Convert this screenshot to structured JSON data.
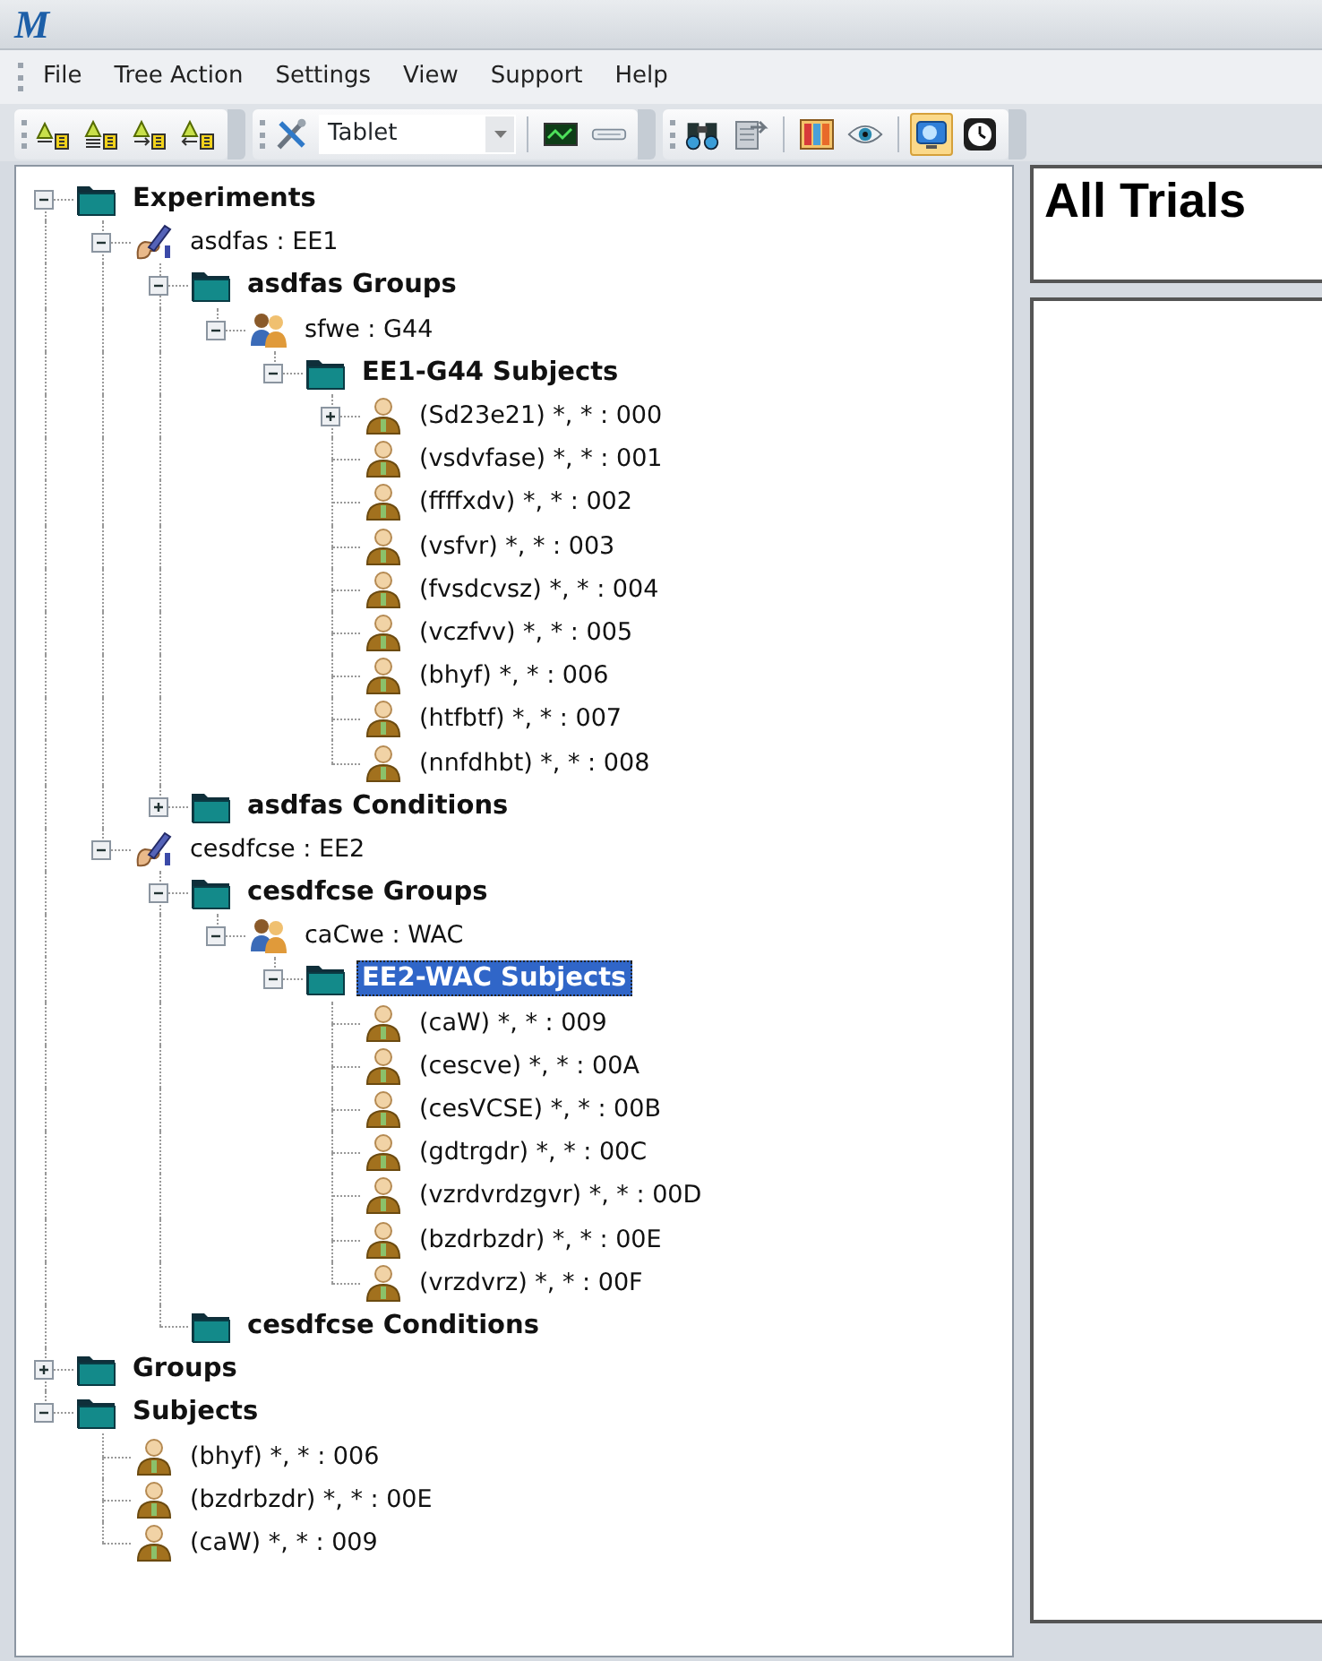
{
  "window": {
    "title": "M"
  },
  "menu": [
    "File",
    "Tree Action",
    "Settings",
    "View",
    "Support",
    "Help"
  ],
  "toolbars": [
    {
      "items": [
        {
          "kind": "sort-a",
          "pressed": false
        },
        {
          "kind": "sort-b",
          "pressed": false
        },
        {
          "kind": "sort-c",
          "pressed": false
        },
        {
          "kind": "sort-d",
          "pressed": false
        }
      ]
    },
    {
      "items": [
        {
          "kind": "tools",
          "pressed": false
        },
        {
          "kind": "combo",
          "value": "Tablet"
        },
        {
          "kind": "separator"
        },
        {
          "kind": "monitor-wave",
          "pressed": false
        },
        {
          "kind": "bar",
          "pressed": false
        }
      ]
    },
    {
      "items": [
        {
          "kind": "binoculars",
          "pressed": false
        },
        {
          "kind": "doc-arrow",
          "pressed": false
        },
        {
          "kind": "separator"
        },
        {
          "kind": "color-bars",
          "pressed": false
        },
        {
          "kind": "eye",
          "pressed": false
        },
        {
          "kind": "separator"
        },
        {
          "kind": "globe-monitor",
          "pressed": true
        },
        {
          "kind": "clock",
          "pressed": false
        }
      ]
    }
  ],
  "tree": [
    {
      "kind": "folder",
      "label": "Experiments",
      "expanded": true,
      "selected": false,
      "children": [
        {
          "kind": "experiment",
          "label": "asdfas : EE1",
          "expanded": true,
          "selected": false,
          "children": [
            {
              "kind": "folder",
              "label": "asdfas Groups",
              "expanded": true,
              "selected": false,
              "children": [
                {
                  "kind": "group",
                  "label": "sfwe : G44",
                  "expanded": true,
                  "selected": false,
                  "children": [
                    {
                      "kind": "folder",
                      "label": "EE1-G44 Subjects",
                      "expanded": true,
                      "selected": false,
                      "children": [
                        {
                          "kind": "subject",
                          "label": "(Sd23e21) *, * : 000",
                          "expanded": false,
                          "selected": false
                        },
                        {
                          "kind": "subject",
                          "label": "(vsdvfase) *, * : 001",
                          "selected": false
                        },
                        {
                          "kind": "subject",
                          "label": "(ffffxdv) *, * : 002",
                          "selected": false
                        },
                        {
                          "kind": "subject",
                          "label": "(vsfvr) *, * : 003",
                          "selected": false
                        },
                        {
                          "kind": "subject",
                          "label": "(fvsdcvsz) *, * : 004",
                          "selected": false
                        },
                        {
                          "kind": "subject",
                          "label": "(vczfvv) *, * : 005",
                          "selected": false
                        },
                        {
                          "kind": "subject",
                          "label": "(bhyf) *, * : 006",
                          "selected": false
                        },
                        {
                          "kind": "subject",
                          "label": "(htfbtf) *, * : 007",
                          "selected": false
                        },
                        {
                          "kind": "subject",
                          "label": "(nnfdhbt) *, * : 008",
                          "selected": false
                        }
                      ]
                    }
                  ]
                }
              ]
            },
            {
              "kind": "folder",
              "label": "asdfas Conditions",
              "expanded": false,
              "selected": false
            }
          ]
        },
        {
          "kind": "experiment",
          "label": "cesdfcse : EE2",
          "expanded": true,
          "selected": false,
          "children": [
            {
              "kind": "folder",
              "label": "cesdfcse Groups",
              "expanded": true,
              "selected": false,
              "children": [
                {
                  "kind": "group",
                  "label": "caCwe : WAC",
                  "expanded": true,
                  "selected": false,
                  "children": [
                    {
                      "kind": "folder",
                      "label": "EE2-WAC Subjects",
                      "expanded": true,
                      "selected": true,
                      "children": [
                        {
                          "kind": "subject",
                          "label": "(caW) *, * : 009",
                          "selected": false
                        },
                        {
                          "kind": "subject",
                          "label": "(cescve) *, * : 00A",
                          "selected": false
                        },
                        {
                          "kind": "subject",
                          "label": "(cesVCSE) *, * : 00B",
                          "selected": false
                        },
                        {
                          "kind": "subject",
                          "label": "(gdtrgdr) *, * : 00C",
                          "selected": false
                        },
                        {
                          "kind": "subject",
                          "label": "(vzrdvrdzgvr) *, * : 00D",
                          "selected": false
                        },
                        {
                          "kind": "subject",
                          "label": "(bzdrbzdr) *, * : 00E",
                          "selected": false
                        },
                        {
                          "kind": "subject",
                          "label": "(vrzdvrz) *, * : 00F",
                          "selected": false
                        }
                      ]
                    }
                  ]
                }
              ]
            },
            {
              "kind": "folder",
              "label": "cesdfcse Conditions",
              "selected": false
            }
          ]
        }
      ]
    },
    {
      "kind": "folder",
      "label": "Groups",
      "expanded": false,
      "selected": false
    },
    {
      "kind": "folder",
      "label": "Subjects",
      "expanded": true,
      "selected": false,
      "children": [
        {
          "kind": "subject",
          "label": "(bhyf) *, * : 006",
          "selected": false
        },
        {
          "kind": "subject",
          "label": "(bzdrbzdr) *, * : 00E",
          "selected": false
        },
        {
          "kind": "subject",
          "label": "(caW) *, * : 009",
          "selected": false
        }
      ]
    }
  ],
  "right_panel": {
    "title": "All Trials"
  }
}
